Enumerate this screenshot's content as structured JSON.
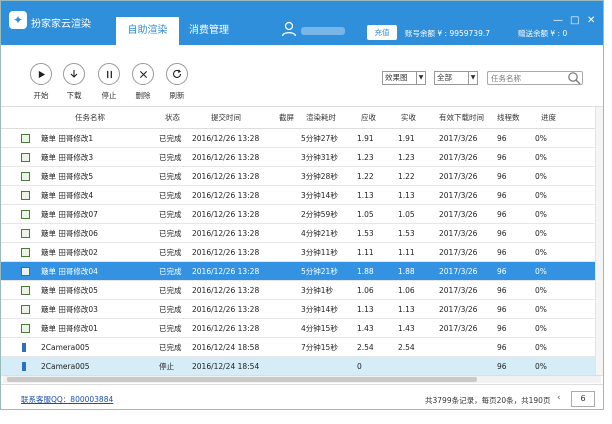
{
  "header": {
    "app_name": "扮家家云渲染",
    "logo_glyph": "✦",
    "tabs": [
      {
        "label": "自助渲染",
        "active": true
      },
      {
        "label": "消费管理",
        "active": false
      }
    ],
    "recharge_label": "充值",
    "balance": "账号余额 ¥ : 9959739.7",
    "gift_balance": "赠送余额 ¥ : 0",
    "window_controls": [
      "—",
      "□",
      "✕"
    ],
    "accent_color": "#2f8fda"
  },
  "toolbar": {
    "buttons": [
      {
        "label": "开始",
        "icon": "play-icon"
      },
      {
        "label": "下载",
        "icon": "download-icon"
      },
      {
        "label": "停止",
        "icon": "pause-icon"
      },
      {
        "label": "删除",
        "icon": "close-icon"
      },
      {
        "label": "刷新",
        "icon": "refresh-icon"
      }
    ],
    "view_select": "效果图",
    "filter_select": "全部",
    "search_placeholder": "任务名称"
  },
  "table": {
    "columns": [
      "任务名称",
      "状态",
      "提交时间",
      "截屏",
      "渲染耗时",
      "应收",
      "实收",
      "有效下载时间",
      "线程数",
      "进度"
    ],
    "rows": [
      {
        "icon": "image-icon",
        "name": "簸单 田哥修改1",
        "status": "已完成",
        "submit": "2016/12/26 13:28",
        "shot": "",
        "duration": "5分钟27秒",
        "due": "1.91",
        "paid": "1.91",
        "expire": "2017/3/26",
        "threads": "96",
        "progress": "0%",
        "style": ""
      },
      {
        "icon": "image-icon",
        "name": "簸单 田哥修改3",
        "status": "已完成",
        "submit": "2016/12/26 13:28",
        "shot": "",
        "duration": "3分钟31秒",
        "due": "1.23",
        "paid": "1.23",
        "expire": "2017/3/26",
        "threads": "96",
        "progress": "0%",
        "style": ""
      },
      {
        "icon": "image-icon",
        "name": "簸单 田哥修改5",
        "status": "已完成",
        "submit": "2016/12/26 13:28",
        "shot": "",
        "duration": "3分钟28秒",
        "due": "1.22",
        "paid": "1.22",
        "expire": "2017/3/26",
        "threads": "96",
        "progress": "0%",
        "style": ""
      },
      {
        "icon": "image-icon",
        "name": "簸单 田哥修改4",
        "status": "已完成",
        "submit": "2016/12/26 13:28",
        "shot": "",
        "duration": "3分钟14秒",
        "due": "1.13",
        "paid": "1.13",
        "expire": "2017/3/26",
        "threads": "96",
        "progress": "0%",
        "style": ""
      },
      {
        "icon": "image-icon",
        "name": "簸单 田哥修改07",
        "status": "已完成",
        "submit": "2016/12/26 13:28",
        "shot": "",
        "duration": "2分钟59秒",
        "due": "1.05",
        "paid": "1.05",
        "expire": "2017/3/26",
        "threads": "96",
        "progress": "0%",
        "style": ""
      },
      {
        "icon": "image-icon",
        "name": "簸单 田哥修改06",
        "status": "已完成",
        "submit": "2016/12/26 13:28",
        "shot": "",
        "duration": "4分钟21秒",
        "due": "1.53",
        "paid": "1.53",
        "expire": "2017/3/26",
        "threads": "96",
        "progress": "0%",
        "style": ""
      },
      {
        "icon": "image-icon",
        "name": "簸单 田哥修改02",
        "status": "已完成",
        "submit": "2016/12/26 13:28",
        "shot": "",
        "duration": "3分钟11秒",
        "due": "1.11",
        "paid": "1.11",
        "expire": "2017/3/26",
        "threads": "96",
        "progress": "0%",
        "style": ""
      },
      {
        "icon": "image-icon",
        "name": "簸单 田哥修改04",
        "status": "已完成",
        "submit": "2016/12/26 13:28",
        "shot": "",
        "duration": "5分钟21秒",
        "due": "1.88",
        "paid": "1.88",
        "expire": "2017/3/26",
        "threads": "96",
        "progress": "0%",
        "style": "selected"
      },
      {
        "icon": "image-icon",
        "name": "簸单 田哥修改05",
        "status": "已完成",
        "submit": "2016/12/26 13:28",
        "shot": "",
        "duration": "3分钟1秒",
        "due": "1.06",
        "paid": "1.06",
        "expire": "2017/3/26",
        "threads": "96",
        "progress": "0%",
        "style": ""
      },
      {
        "icon": "image-icon",
        "name": "簸单 田哥修改03",
        "status": "已完成",
        "submit": "2016/12/26 13:28",
        "shot": "",
        "duration": "3分钟14秒",
        "due": "1.13",
        "paid": "1.13",
        "expire": "2017/3/26",
        "threads": "96",
        "progress": "0%",
        "style": ""
      },
      {
        "icon": "image-icon",
        "name": "簸单 田哥修改01",
        "status": "已完成",
        "submit": "2016/12/26 13:28",
        "shot": "",
        "duration": "4分钟15秒",
        "due": "1.43",
        "paid": "1.43",
        "expire": "2017/3/26",
        "threads": "96",
        "progress": "0%",
        "style": ""
      },
      {
        "icon": "camera-icon",
        "name": "2Camera005",
        "status": "已完成",
        "submit": "2016/12/24 18:58",
        "shot": "",
        "duration": "7分钟15秒",
        "due": "2.54",
        "paid": "2.54",
        "expire": "",
        "threads": "96",
        "progress": "0%",
        "style": ""
      },
      {
        "icon": "camera-icon",
        "name": "2Camera005",
        "status": "停止",
        "submit": "2016/12/24 18:54",
        "shot": "",
        "duration": "",
        "due": "0",
        "paid": "",
        "expire": "",
        "threads": "96",
        "progress": "0%",
        "style": "faded"
      }
    ]
  },
  "footer": {
    "qq_link": "联系客服QQ：800003884",
    "summary": "共3799条记录，每页20条，共190页",
    "prev_glyph": "‹",
    "page": "6"
  }
}
